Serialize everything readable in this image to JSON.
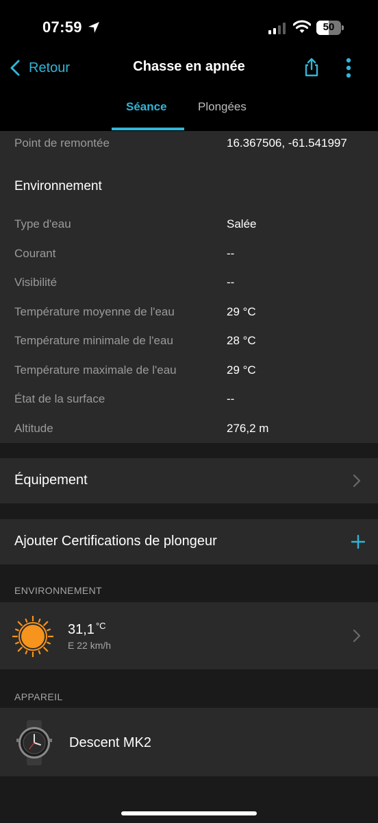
{
  "status_bar": {
    "time": "07:59",
    "battery": "50",
    "battery_level_percent": 50
  },
  "nav": {
    "back_label": "Retour",
    "title": "Chasse en apnée"
  },
  "tabs": [
    {
      "label": "Séance",
      "active": true
    },
    {
      "label": "Plongées",
      "active": false
    }
  ],
  "details": {
    "ascent_point": {
      "label": "Point de remontée",
      "value": "16.367506, -61.541997"
    },
    "environment_title": "Environnement",
    "rows": [
      {
        "label": "Type d'eau",
        "value": "Salée"
      },
      {
        "label": "Courant",
        "value": "--"
      },
      {
        "label": "Visibilité",
        "value": "--"
      },
      {
        "label": "Température moyenne de l'eau",
        "value": "29 °C"
      },
      {
        "label": "Température minimale de l'eau",
        "value": "28 °C"
      },
      {
        "label": "Température maximale de l'eau",
        "value": "29 °C"
      },
      {
        "label": "État de la surface",
        "value": "--"
      },
      {
        "label": "Altitude",
        "value": "276,2 m"
      }
    ]
  },
  "equipment": {
    "label": "Équipement"
  },
  "certifications": {
    "label": "Ajouter Certifications de plongeur"
  },
  "environment_section": {
    "header": "ENVIRONNEMENT",
    "temperature": "31,1",
    "temperature_unit": "°C",
    "wind": "E 22 km/h"
  },
  "device_section": {
    "header": "APPAREIL",
    "device_name": "Descent MK2"
  },
  "colors": {
    "accent": "#2fb6d8",
    "background": "#1a1a1a",
    "card": "#2a2a2a",
    "header": "#000000",
    "sun": "#f7941d"
  },
  "icons": [
    "location-arrow-icon",
    "signal-icon",
    "wifi-icon",
    "battery-icon",
    "chevron-left-icon",
    "share-icon",
    "more-vertical-icon",
    "chevron-right-icon",
    "plus-icon",
    "sun-icon",
    "watch-icon"
  ]
}
